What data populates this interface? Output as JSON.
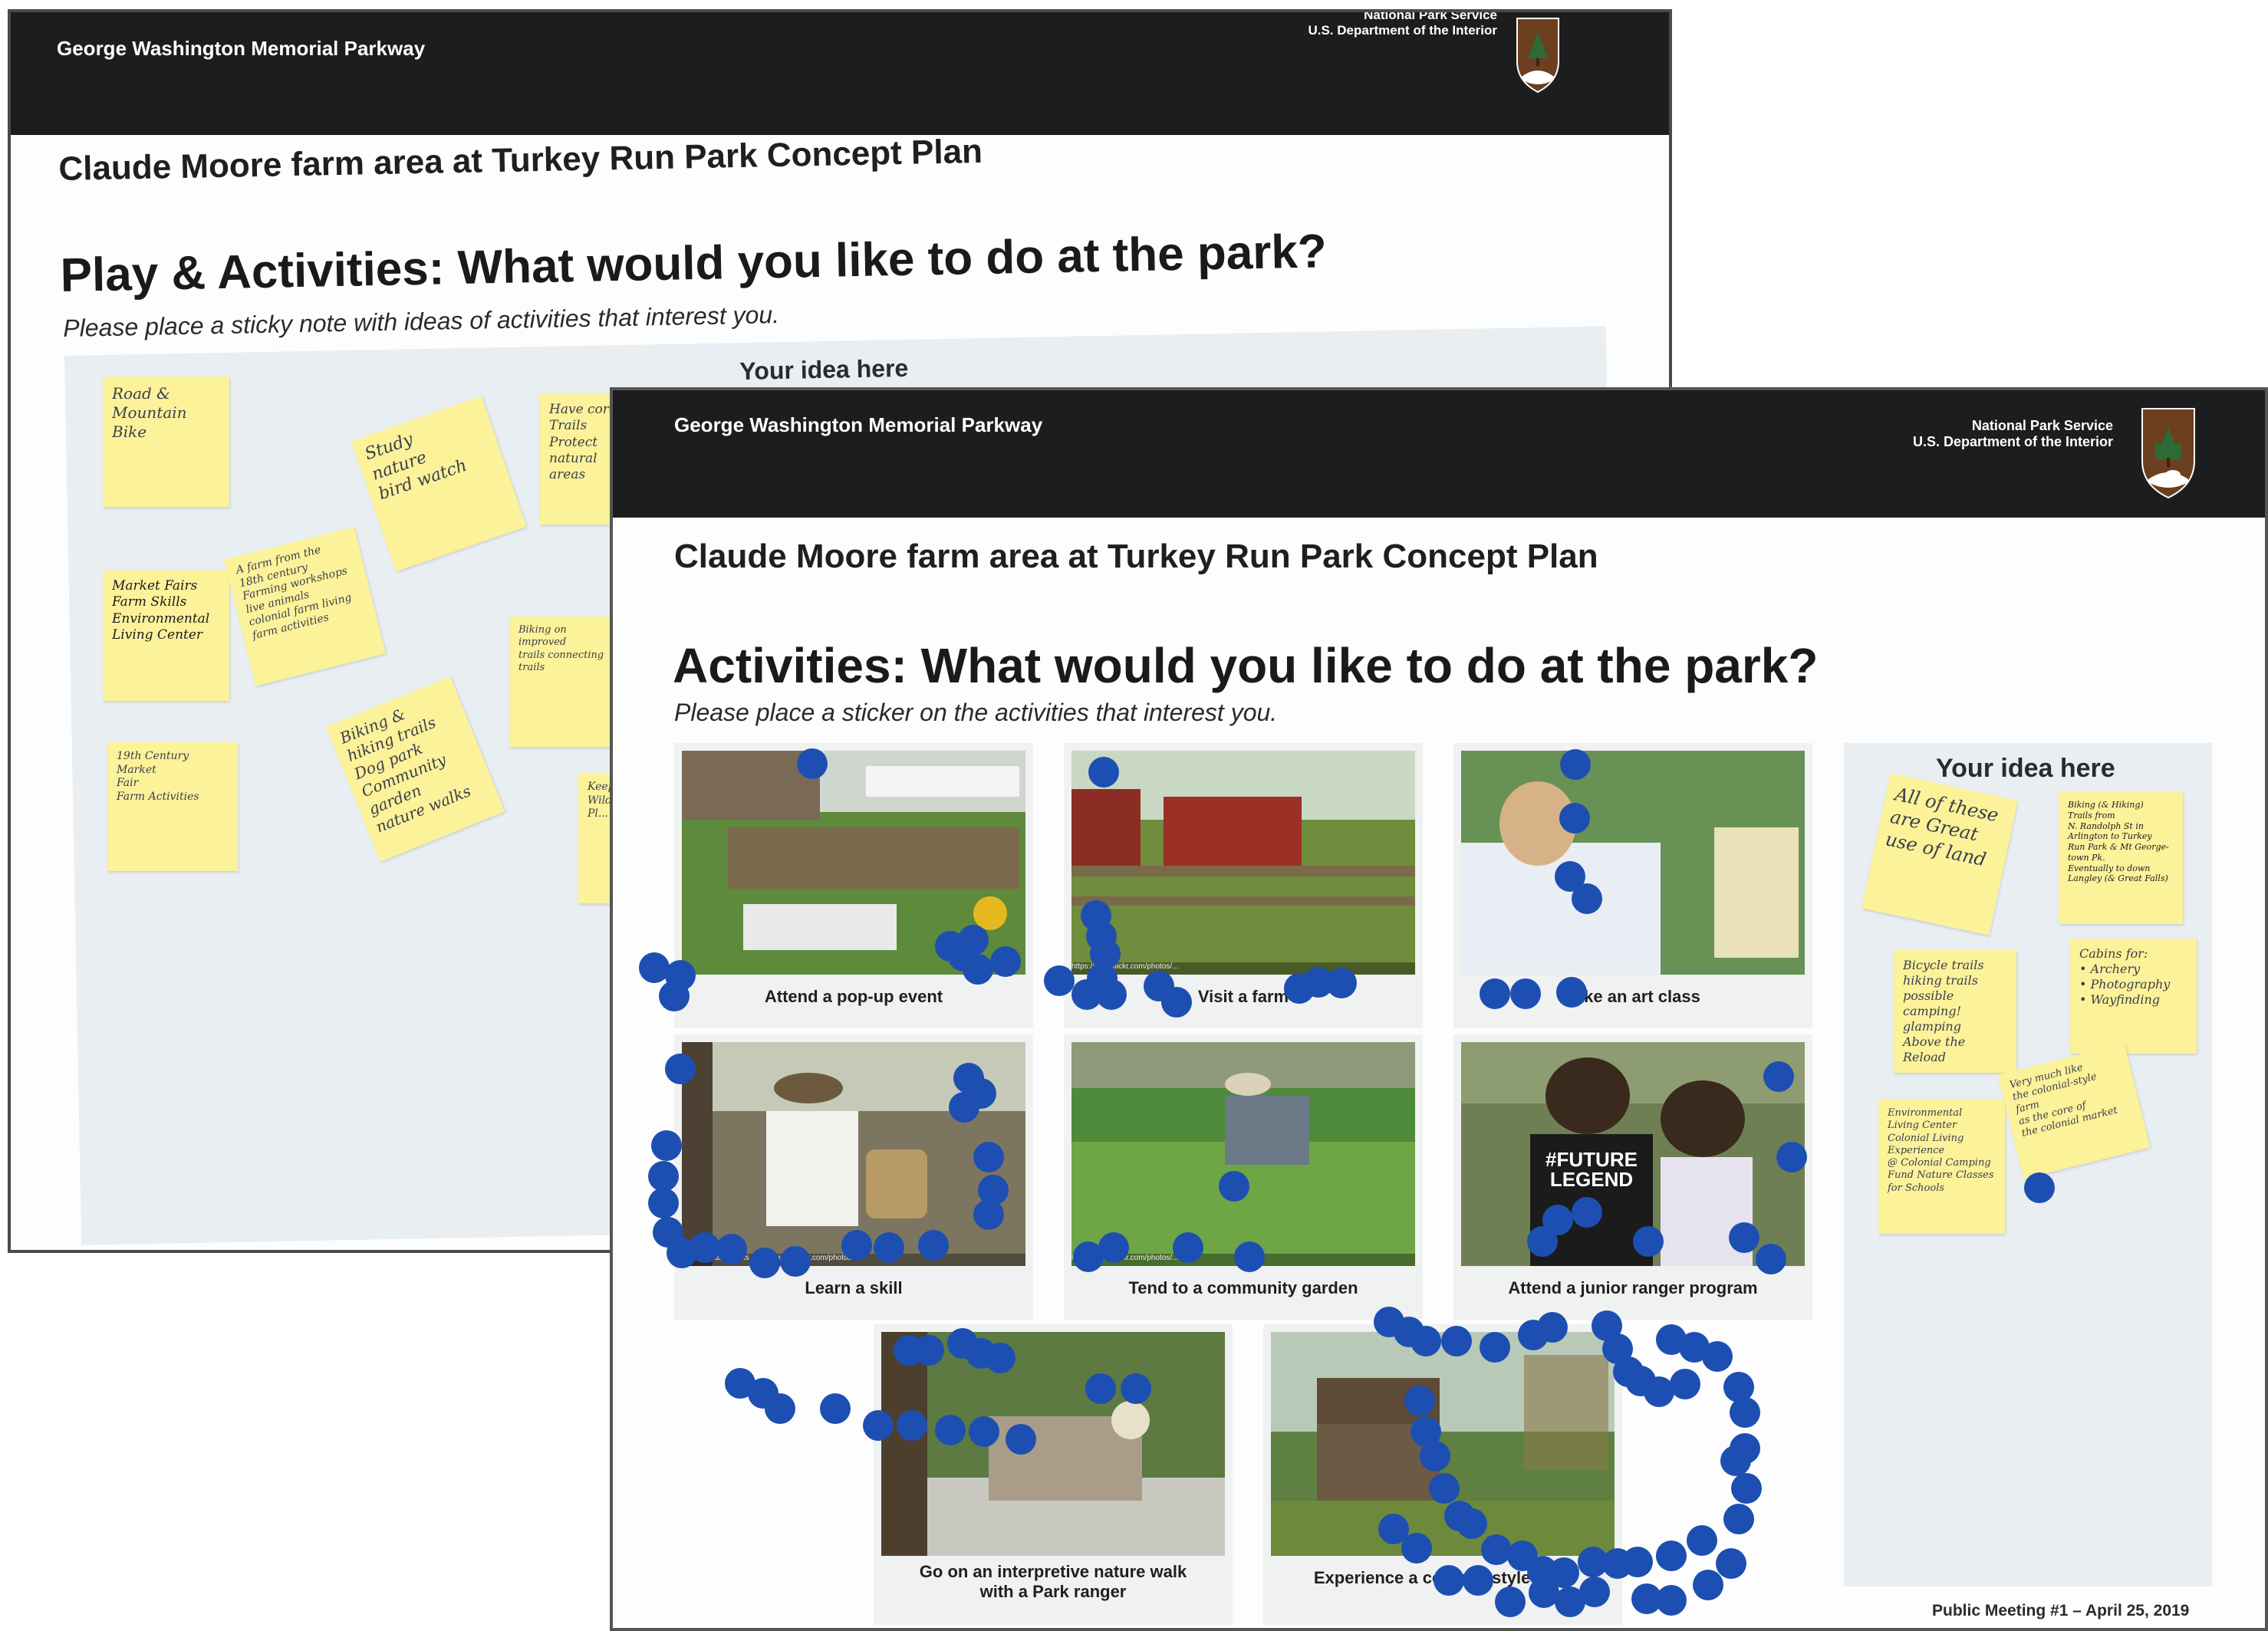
{
  "back_poster": {
    "park_name": "George Washington Memorial Parkway",
    "agency_line1": "National Park Service",
    "agency_line2": "U.S. Department of the Interior",
    "badge_text": "NATIONAL PARK SERVICE",
    "plan_title": "Claude Moore farm area at Turkey Run Park Concept Plan",
    "question_title": "Play & Activities: What would you like to do at the park?",
    "instruction": "Please place a sticky note with ideas of activities that interest you.",
    "idea_label": "Your idea here",
    "sticky_notes": [
      "Road &\nMountain\nBike",
      "Study\nnature\nbird watch",
      "Have core\nTrails\nProtect\nnatural\nareas",
      "Market Fairs\nFarm Skills\nEnvironmental\nLiving Center",
      "A farm from the\n18th century\nFarming workshops\nlive animals\ncolonial farm living\nfarm activities",
      "Biking on improved\ntrails connecting\ntrails",
      "19th Century Market\nFair\nFarm Activities",
      "Biking &\nhiking trails\nDog park\nCommunity\ngarden\nnature walks",
      "Keep\nWildlife\nPl..."
    ]
  },
  "front_poster": {
    "park_name": "George Washington Memorial Parkway",
    "agency_line1": "National Park Service",
    "agency_line2": "U.S. Department of the Interior",
    "badge_text": "NATIONAL PARK SERVICE",
    "plan_title": "Claude Moore farm area at Turkey Run Park Concept Plan",
    "question_title": "Activities: What would you like to do at the park?",
    "instruction": "Please place a sticker on the activities that interest you.",
    "idea_label": "Your idea here",
    "footer": "Public Meeting #1 – April 25, 2019",
    "activities": [
      {
        "caption": "Attend a pop-up event"
      },
      {
        "caption": "Visit a farm",
        "photo_credit": "https://www.flickr.com/photos/..."
      },
      {
        "caption": "Take an art class"
      },
      {
        "caption": "Learn a skill",
        "photo_credit": "Virginia State Parks, https://www.flickr.com/photos/..."
      },
      {
        "caption": "Tend to a community garden",
        "photo_credit": "https://www.flickr.com/photos/..."
      },
      {
        "caption": "Attend a junior ranger program",
        "shirt_text": "#FUTURE LEGEND"
      },
      {
        "caption": "Go on an interpretive nature walk with a Park ranger"
      },
      {
        "caption": "Experience a colonial-style farm"
      }
    ],
    "sticky_notes": [
      "All of these\nare Great\nuse of land",
      "Biking (& Hiking)\nTrails from\nN. Randolph St in\nArlington to Turkey\nRun Park & Mt George-\ntown Pk.\nEventually to down\nLangley (& Great Falls)",
      "Bicycle trails\nhiking trails\npossible\ncamping!\nglamping\nAbove the Reload",
      "Cabins for:\n• Archery\n• Photography\n• Wayfinding",
      "Environmental\nLiving Center\nColonial Living\nExperience\n@ Colonial Camping\nFund Nature Classes\nfor Schools",
      "Very much like\nthe colonial-style farm\nas the core of\nthe colonial market"
    ]
  },
  "colors": {
    "header_bg": "#1d1d1d",
    "sticky_yellow": "#fbf29a",
    "dot_blue": "#1d4fb2",
    "idea_panel": "#e8eef1",
    "nps_brown": "#6b3f1f"
  }
}
